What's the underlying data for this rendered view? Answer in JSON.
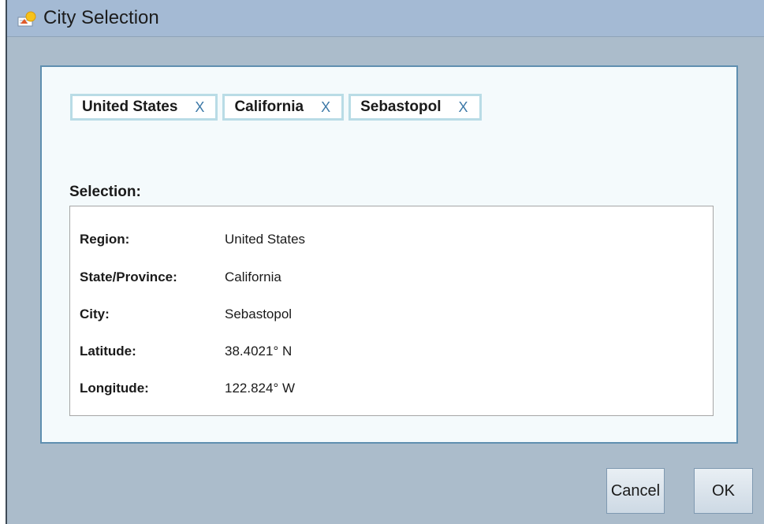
{
  "window": {
    "title": "City Selection",
    "icon": "city-selection-app-icon"
  },
  "chips": [
    {
      "label": "United States",
      "remove_glyph": "X"
    },
    {
      "label": "California",
      "remove_glyph": "X"
    },
    {
      "label": "Sebastopol",
      "remove_glyph": "X"
    }
  ],
  "selection": {
    "heading": "Selection:",
    "rows": [
      {
        "key": "Region:",
        "value": "United States"
      },
      {
        "key": "State/Province:",
        "value": "California"
      },
      {
        "key": "City:",
        "value": "Sebastopol"
      },
      {
        "key": "Latitude:",
        "value": "38.4021° N"
      },
      {
        "key": "Longitude:",
        "value": "122.824° W"
      }
    ]
  },
  "buttons": {
    "cancel_label": "Cancel",
    "ok_label": "OK"
  },
  "colors": {
    "window_bg": "#abbccb",
    "titlebar_bg": "#a4bad4",
    "panel_bg": "#f4fafc",
    "panel_border": "#5f8fb0",
    "chip_border": "#b9dce6",
    "chip_remove": "#3d79a7"
  }
}
